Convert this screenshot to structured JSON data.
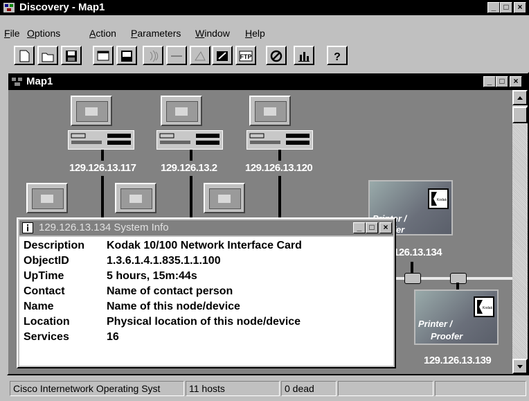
{
  "window": {
    "title": "Discovery - Map1",
    "icon": "network-map-icon"
  },
  "menu": [
    {
      "label": "File",
      "accel": "F"
    },
    {
      "label": "Options",
      "accel": "O"
    },
    {
      "label": "Action",
      "accel": "A"
    },
    {
      "label": "Parameters",
      "accel": "P"
    },
    {
      "label": "Window",
      "accel": "W"
    },
    {
      "label": "Help",
      "accel": "H"
    }
  ],
  "toolbar": {
    "icons": [
      "new-icon",
      "open-icon",
      "save-icon",
      "properties-icon",
      "ip-display-icon",
      "ping-icon",
      "trace-icon",
      "telnet-icon",
      "snmp-icon",
      "ftp-icon",
      "stop-icon",
      "statistics-icon",
      "help-icon"
    ],
    "ftp_text": "FTP",
    "help_text": "?"
  },
  "map": {
    "title": "Map1",
    "hubs": [
      {
        "ip": "129.126.13.117"
      },
      {
        "ip": "129.126.13.2"
      },
      {
        "ip": "129.126.13.120"
      }
    ],
    "printers": [
      {
        "label_1": "Printer /",
        "label_2": "Proofer",
        "ip": "126.13.134"
      },
      {
        "label_1": "Printer /",
        "label_2": "Proofer",
        "ip": "129.126.13.139"
      }
    ],
    "kodak_text": "Kodak"
  },
  "dialog": {
    "title": "129.126.13.134 System Info",
    "rows": [
      {
        "key": "Description",
        "value": "Kodak 10/100 Network Interface Card"
      },
      {
        "key": "ObjectID",
        "value": "1.3.6.1.4.1.835.1.1.100"
      },
      {
        "key": "UpTime",
        "value": "5 hours, 15m:44s"
      },
      {
        "key": "Contact",
        "value": "Name of contact person"
      },
      {
        "key": "Name",
        "value": "Name of this node/device"
      },
      {
        "key": "Location",
        "value": "Physical location of this node/device"
      },
      {
        "key": "Services",
        "value": "16"
      }
    ]
  },
  "statusbar": {
    "system": "Cisco Internetwork Operating Syst",
    "hosts": "11 hosts",
    "dead": "0 dead"
  },
  "controls": {
    "minimize": "_",
    "maximize": "□",
    "close": "×"
  }
}
